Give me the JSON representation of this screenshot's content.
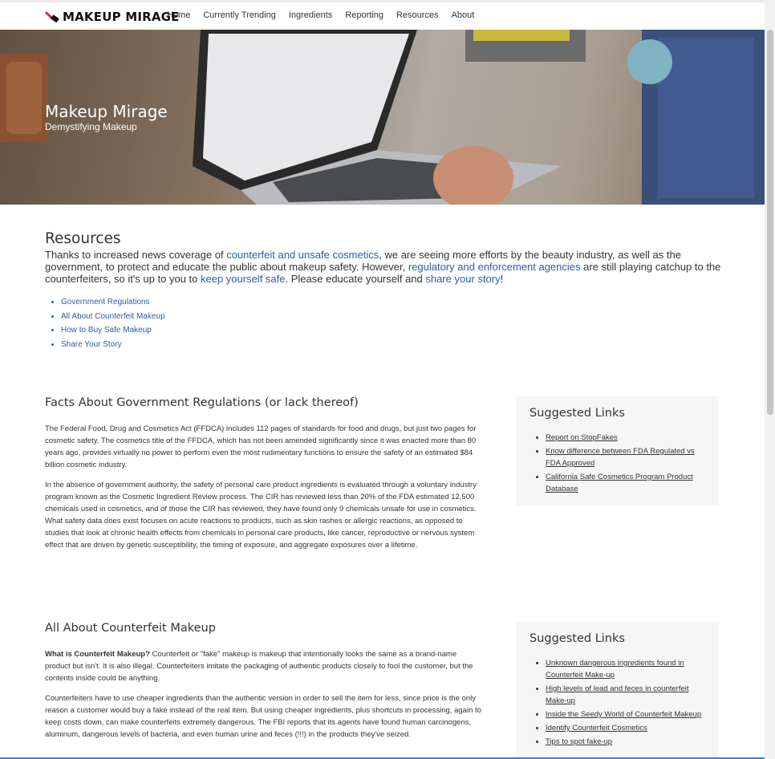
{
  "brand": {
    "name": "MAKEUP MIRAGE"
  },
  "nav": [
    "Home",
    "Currently Trending",
    "Ingredients",
    "Reporting",
    "Resources",
    "About"
  ],
  "hero": {
    "title": "Makeup Mirage",
    "subtitle": "Demystifying Makeup"
  },
  "resources": {
    "title": "Resources",
    "intro": {
      "t1": "Thanks to increased news coverage of ",
      "l1": "counterfeit and unsafe cosmetics",
      "t2": ", we are seeing more efforts by the beauty industry, as well as the government, to protect and educate the public about makeup safety. However, ",
      "l2": "regulatory and enforcement agencies",
      "t3": " are still playing catchup to the counterfeiters, so it's up to you to ",
      "l3": "keep yourself safe",
      "t4": ". Please educate yourself and ",
      "l4": "share your story",
      "t5": "!"
    },
    "toc": [
      "Government Regulations",
      "All About Counterfeit Makeup",
      "How to Buy Safe Makeup",
      "Share Your Story"
    ]
  },
  "gov": {
    "title": "Facts About Government Regulations (or lack thereof)",
    "p1": "The Federal Food, Drug and Cosmetics Act (FFDCA) includes 112 pages of standards for food and drugs, but just two pages for cosmetic safety. The cosmetics title of the FFDCA, which has not been amended significantly since it was enacted more than 80 years ago, provides virtually no power to perform even the most rudimentary functions to ensure the safety of an estimated $84 billion cosmetic industry.",
    "p2": "In the absence of government authority, the safety of personal care product ingredients is evaluated through a voluntary industry program known as the Cosmetic Ingredient Review process. The CIR has reviewed less than 20% of the FDA estimated 12,500 chemicals used in cosmetics, and of those the CIR has reviewed, they have found only 9 chemicals unsafe for use in cosmetics. What safety data does exist focuses on acute reactions to products, such as skin rashes or allergic reactions, as opposed to studies that look at chronic health effects from chemicals in personal care products, like cancer, reproductive or nervous system effect that are driven by genetic susceptibility, the timing of exposure, and aggregate exposures over a lifetime.",
    "panel": {
      "title": "Suggested Links",
      "links": [
        "Report on StopFakes",
        "Know difference between FDA Regulated vs FDA Approved",
        "California Safe Cosmetics Program Product Database"
      ]
    }
  },
  "counterfeit": {
    "title": "All About Counterfeit Makeup",
    "p1_bold": "What is Counterfeit Makeup?",
    "p1": " Counterfeit or \"fake\" makeup is makeup that intentionally looks the same as a brand-name product but isn't. It is also illegal. Counterfeiters imitate the packaging of authentic products closely to fool the customer, but the contents inside could be anything.",
    "p2": "Counterfeiters have to use cheaper ingredients than the authentic version in order to sell the item for less, since price is the only reason a customer would buy a fake instead of the real item. But using cheaper ingredients, plus shortcuts in processing, again to keep costs down, can make counterfeits extremely dangerous. The FBI reports that its agents have found human carcinogens, aluminum, dangerous levels of bacteria, and even human urine and feces (!!!) in the products they've seized.",
    "panel": {
      "title": "Suggested Links",
      "links": [
        "Unknown dangerous ingredients found in Counterfeit Make-up",
        "High levels of lead and feces in counterfeit Make-up",
        "Inside the Seedy World of Counterfeit Makeup",
        "Identify Counterfeit Cosmetics",
        "Tips to spot fake-up"
      ]
    }
  }
}
